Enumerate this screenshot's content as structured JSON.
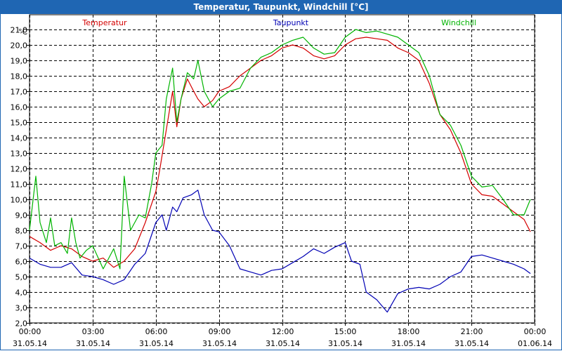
{
  "window": {
    "title": "Temperatur, Taupunkt, Windchill [°C]"
  },
  "chart_data": {
    "type": "line",
    "title": "Temperatur, Taupunkt, Windchill [°C]",
    "ylabel": "°C",
    "ylim": [
      2.0,
      22.0
    ],
    "yticks": [
      "2,0",
      "3,0",
      "4,0",
      "5,0",
      "6,0",
      "7,0",
      "8,0",
      "9,0",
      "10,0",
      "11,0",
      "12,0",
      "13,0",
      "14,0",
      "15,0",
      "16,0",
      "17,0",
      "18,0",
      "19,0",
      "20,0",
      "21,0"
    ],
    "xlim": [
      0,
      24
    ],
    "xticks": [
      {
        "time": "00:00",
        "date": "31.05.14"
      },
      {
        "time": "03:00",
        "date": "31.05.14"
      },
      {
        "time": "06:00",
        "date": "31.05.14"
      },
      {
        "time": "09:00",
        "date": "31.05.14"
      },
      {
        "time": "12:00",
        "date": "31.05.14"
      },
      {
        "time": "15:00",
        "date": "31.05.14"
      },
      {
        "time": "18:00",
        "date": "31.05.14"
      },
      {
        "time": "21:00",
        "date": "31.05.14"
      },
      {
        "time": "00:00",
        "date": "01.06.14"
      }
    ],
    "grid": true,
    "legend_position": "top",
    "series": [
      {
        "name": "Temperatur",
        "color": "#d40000",
        "x": [
          0,
          0.5,
          1,
          1.5,
          2,
          2.5,
          3,
          3.5,
          4,
          4.5,
          5,
          5.5,
          6,
          6.2,
          6.5,
          6.8,
          7,
          7.2,
          7.5,
          7.8,
          8,
          8.3,
          8.7,
          9,
          9.5,
          10,
          10.5,
          11,
          11.5,
          12,
          12.5,
          13,
          13.5,
          14,
          14.5,
          15,
          15.5,
          16,
          16.5,
          17,
          17.5,
          18,
          18.5,
          19,
          19.5,
          20,
          20.5,
          21,
          21.5,
          22,
          22.5,
          23,
          23.5,
          23.8
        ],
        "values": [
          7.6,
          7.2,
          6.7,
          7.0,
          6.8,
          6.3,
          6.0,
          6.2,
          5.6,
          6.0,
          6.8,
          8.5,
          10.5,
          12.0,
          14.5,
          17.0,
          14.7,
          16.5,
          17.8,
          17.0,
          16.5,
          16.0,
          16.4,
          17.0,
          17.3,
          18.0,
          18.5,
          19.0,
          19.3,
          19.8,
          20.0,
          19.8,
          19.3,
          19.1,
          19.3,
          20.0,
          20.4,
          20.5,
          20.4,
          20.3,
          19.8,
          19.5,
          19.0,
          17.5,
          15.5,
          14.5,
          13.0,
          11.0,
          10.3,
          10.2,
          9.7,
          9.2,
          8.7,
          7.9
        ]
      },
      {
        "name": "Taupunkt",
        "color": "#0000b4",
        "x": [
          0,
          0.5,
          1,
          1.5,
          2,
          2.5,
          3,
          3.5,
          4,
          4.5,
          5,
          5.5,
          6,
          6.3,
          6.5,
          6.8,
          7,
          7.3,
          7.7,
          8,
          8.3,
          8.7,
          9,
          9.5,
          10,
          10.5,
          11,
          11.5,
          12,
          12.5,
          13,
          13.5,
          14,
          14.5,
          15,
          15.3,
          15.7,
          16,
          16.5,
          17,
          17.5,
          18,
          18.5,
          19,
          19.5,
          20,
          20.5,
          21,
          21.5,
          22,
          22.5,
          23,
          23.5,
          23.8
        ],
        "values": [
          6.2,
          5.8,
          5.6,
          5.6,
          5.9,
          5.1,
          5.0,
          4.8,
          4.5,
          4.8,
          5.8,
          6.5,
          8.5,
          9.0,
          8.0,
          9.5,
          9.2,
          10.1,
          10.3,
          10.6,
          9.0,
          8.0,
          7.9,
          7.0,
          5.5,
          5.3,
          5.1,
          5.4,
          5.5,
          5.9,
          6.3,
          6.8,
          6.5,
          6.9,
          7.2,
          6.0,
          5.8,
          4.0,
          3.5,
          2.7,
          3.9,
          4.2,
          4.3,
          4.2,
          4.5,
          5.0,
          5.3,
          6.3,
          6.4,
          6.2,
          6.0,
          5.8,
          5.5,
          5.2
        ]
      },
      {
        "name": "Windchill",
        "color": "#00b400",
        "x": [
          0,
          0.3,
          0.5,
          0.8,
          1,
          1.2,
          1.5,
          1.8,
          2,
          2.2,
          2.4,
          2.7,
          3,
          3.5,
          4,
          4.3,
          4.5,
          4.8,
          5,
          5.2,
          5.5,
          5.8,
          6,
          6.3,
          6.5,
          6.8,
          7,
          7.2,
          7.5,
          7.8,
          8,
          8.3,
          8.7,
          9,
          9.5,
          10,
          10.5,
          11,
          11.5,
          12,
          12.5,
          13,
          13.5,
          14,
          14.5,
          15,
          15.5,
          16,
          16.5,
          17,
          17.5,
          18,
          18.5,
          19,
          19.5,
          20,
          20.5,
          21,
          21.5,
          22,
          22.5,
          23,
          23.5,
          23.8
        ],
        "values": [
          8.0,
          11.5,
          8.5,
          7.2,
          8.8,
          7.0,
          7.2,
          6.5,
          8.8,
          7.2,
          6.2,
          6.7,
          7.0,
          5.5,
          6.8,
          5.5,
          11.5,
          8.0,
          8.5,
          9.0,
          8.8,
          11.0,
          13.0,
          13.5,
          16.5,
          18.5,
          15.0,
          16.5,
          18.2,
          17.8,
          19.0,
          17.0,
          16.0,
          16.5,
          17.0,
          17.2,
          18.5,
          19.2,
          19.5,
          20.0,
          20.3,
          20.5,
          19.8,
          19.4,
          19.5,
          20.5,
          21.0,
          20.8,
          20.9,
          20.7,
          20.5,
          20.0,
          19.5,
          18.0,
          15.5,
          14.8,
          13.5,
          11.5,
          10.8,
          10.9,
          10.0,
          9.0,
          9.0,
          10.0
        ]
      }
    ]
  }
}
